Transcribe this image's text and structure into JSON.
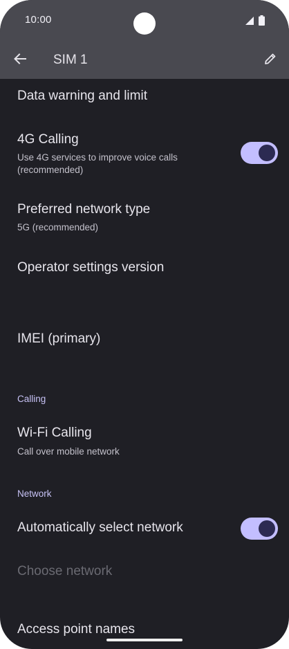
{
  "status_bar": {
    "time": "10:00",
    "icons": [
      "signal-icon",
      "battery-icon"
    ]
  },
  "toolbar": {
    "title": "SIM 1",
    "back_icon": "arrow-back-icon",
    "edit_icon": "pencil-edit-icon"
  },
  "settings": {
    "data_warning": {
      "title": "Data warning and limit"
    },
    "calling_4g": {
      "title": "4G Calling",
      "summary": "Use 4G services to improve voice calls (recommended)",
      "toggle_on": true
    },
    "preferred_network": {
      "title": "Preferred network type",
      "summary": "5G (recommended)"
    },
    "operator_settings": {
      "title": "Operator settings version"
    },
    "imei": {
      "title": "IMEI (primary)"
    },
    "calling_section": {
      "header": "Calling"
    },
    "wifi_calling": {
      "title": "Wi-Fi Calling",
      "summary": "Call over mobile network"
    },
    "network_section": {
      "header": "Network"
    },
    "auto_select": {
      "title": "Automatically select network",
      "toggle_on": true
    },
    "choose_network": {
      "title": "Choose network"
    },
    "access_point_names": {
      "title": "Access point names"
    }
  },
  "colors": {
    "background": "#1f1f25",
    "header": "#494950",
    "toggle_track": "#c3beff",
    "toggle_knob": "#2c2a52",
    "section_header": "#c7c2f5",
    "disabled_text": "#6a6a72"
  }
}
